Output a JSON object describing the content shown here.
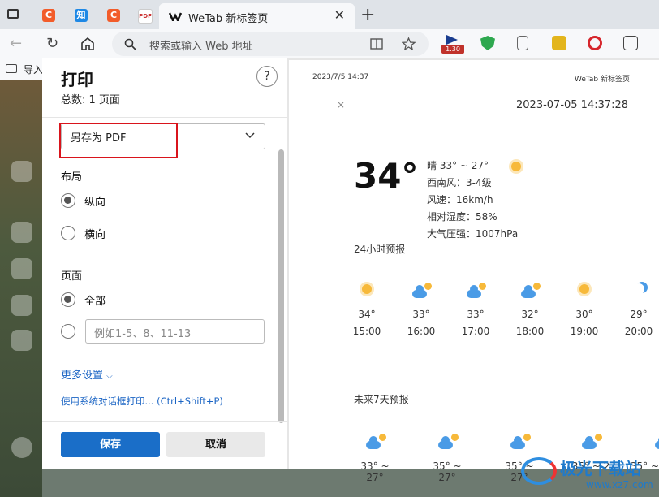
{
  "browser": {
    "tabs": [
      {
        "label": "C",
        "color": "#f25c2a"
      },
      {
        "label": "知",
        "color": "#1e88e5"
      },
      {
        "label": "C",
        "color": "#f25c2a"
      },
      {
        "label": "PDF",
        "color": "#c9c9c9"
      }
    ],
    "active_tab": {
      "title": "WeTab 新标签页"
    },
    "address_placeholder": "搜索或输入 Web 地址",
    "extension_badge": "1.30",
    "bookmark_label": "导入"
  },
  "print": {
    "title": "打印",
    "total": "总数: 1 页面",
    "help": "?",
    "destination": "另存为 PDF",
    "layout_label": "布局",
    "portrait": "纵向",
    "landscape": "横向",
    "pages_label": "页面",
    "all": "全部",
    "pages_placeholder": "例如1-5、8、11-13",
    "more_settings": "更多设置",
    "system_dialog": "使用系统对话框打印... (Ctrl+Shift+P)",
    "save": "保存",
    "cancel": "取消"
  },
  "preview": {
    "header_date": "2023/7/5 14:37",
    "header_title": "WeTab 新标签页",
    "close": "×",
    "datetime": "2023-07-05 14:37:28",
    "temp": "34°",
    "condition": "晴  33° ~ 27°",
    "wind": "西南风：3-4级",
    "speed": "风速：16km/h",
    "humidity": "相对湿度：58%",
    "pressure": "大气压强：1007hPa",
    "hourly_label": "24小时预报",
    "hourly": [
      {
        "icon": "sun-icon",
        "temp": "34°",
        "time": "15:00"
      },
      {
        "icon": "partly-cloudy-icon",
        "temp": "33°",
        "time": "16:00"
      },
      {
        "icon": "partly-cloudy-icon",
        "temp": "33°",
        "time": "17:00"
      },
      {
        "icon": "partly-cloudy-icon",
        "temp": "32°",
        "time": "18:00"
      },
      {
        "icon": "sun-icon",
        "temp": "30°",
        "time": "19:00"
      },
      {
        "icon": "moon-icon",
        "temp": "29°",
        "time": "20:00"
      }
    ],
    "daily_label": "未来7天预报",
    "daily": [
      {
        "icon": "thunder-rain-icon",
        "range": "33° ~ 27°"
      },
      {
        "icon": "partly-cloudy-icon",
        "range": "35° ~ 27°"
      },
      {
        "icon": "partly-cloudy-icon",
        "range": "35° ~ 27°"
      },
      {
        "icon": "partly-cloudy-icon",
        "range": "35° ~ 2"
      },
      {
        "icon": "partly-cloudy-icon",
        "range": "35° ~"
      }
    ]
  },
  "watermark": {
    "name": "极光下载站",
    "url": "www.xz7.com"
  }
}
